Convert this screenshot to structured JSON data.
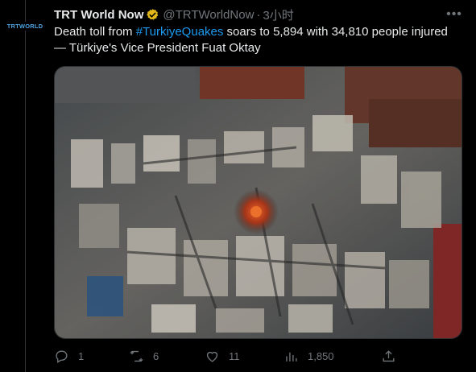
{
  "account": {
    "avatar_text": "TRTWORLD",
    "display_name": "TRT World Now",
    "handle": "@TRTWorldNow",
    "separator": "·",
    "time": "3小时",
    "verified_color": "#e2b719"
  },
  "tweet": {
    "text_before": "Death toll from ",
    "hashtag": "#TurkiyeQuakes",
    "text_after": " soars to 5,894 with 34,810 people injured — Türkiye's Vice President Fuat Oktay"
  },
  "media": {
    "icon": "photo-image"
  },
  "actions": {
    "reply_count": "1",
    "retweet_count": "6",
    "like_count": "11",
    "views_count": "1,850"
  },
  "colors": {
    "background": "#000000",
    "text": "#e7e9ea",
    "secondary": "#71767b",
    "link": "#1d9bf0",
    "divider": "#2f3336"
  }
}
